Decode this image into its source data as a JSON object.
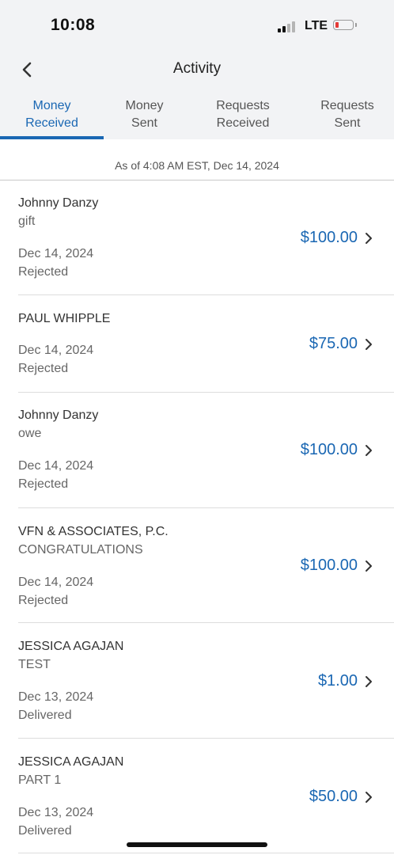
{
  "status_bar": {
    "time": "10:08",
    "network": "LTE",
    "battery_level_fraction": 0.1
  },
  "header": {
    "title": "Activity",
    "back_icon": "chevron-left-icon"
  },
  "tabs": [
    {
      "line1": "Money",
      "line2": "Received",
      "active": true
    },
    {
      "line1": "Money",
      "line2": "Sent",
      "active": false
    },
    {
      "line1": "Requests",
      "line2": "Received",
      "active": false
    },
    {
      "line1": "Requests",
      "line2": "Sent",
      "active": false
    }
  ],
  "as_of": "As of 4:08 AM EST, Dec 14, 2024",
  "transactions": [
    {
      "name": "Johnny Danzy",
      "memo": "gift",
      "date": "Dec 14, 2024",
      "status": "Rejected",
      "amount": "$100.00"
    },
    {
      "name": "PAUL WHIPPLE",
      "memo": "",
      "date": "Dec 14, 2024",
      "status": "Rejected",
      "amount": "$75.00"
    },
    {
      "name": "Johnny Danzy",
      "memo": "owe",
      "date": "Dec 14, 2024",
      "status": "Rejected",
      "amount": "$100.00"
    },
    {
      "name": "VFN & ASSOCIATES, P.C.",
      "memo": "CONGRATULATIONS",
      "date": "Dec 14, 2024",
      "status": "Rejected",
      "amount": "$100.00"
    },
    {
      "name": "JESSICA AGAJAN",
      "memo": "TEST",
      "date": "Dec 13, 2024",
      "status": "Delivered",
      "amount": "$1.00"
    },
    {
      "name": "JESSICA AGAJAN",
      "memo": "PART 1",
      "date": "Dec 13, 2024",
      "status": "Delivered",
      "amount": "$50.00"
    }
  ],
  "colors": {
    "accent": "#1a67b3",
    "header_bg": "#f2f3f5"
  }
}
